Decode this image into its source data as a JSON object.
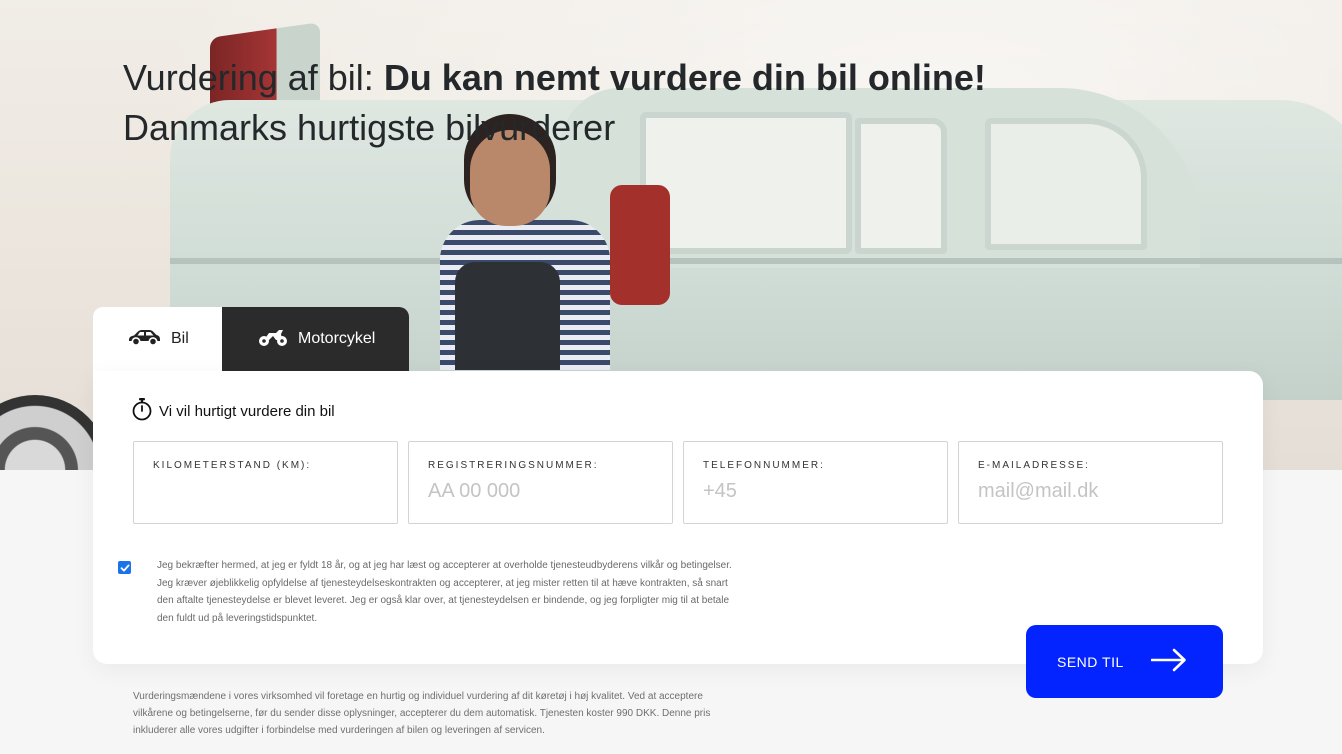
{
  "hero": {
    "title_prefix": "Vurdering af bil: ",
    "title_bold": "Du kan nemt vurdere din bil online!",
    "subtitle": "Danmarks hurtigste bilvurderer"
  },
  "tabs": [
    {
      "label": "Bil",
      "icon": "car-icon",
      "active": true
    },
    {
      "label": "Motorcykel",
      "icon": "motorcycle-icon",
      "active": false
    }
  ],
  "form": {
    "heading": "Vi vil hurtigt vurdere din bil",
    "heading_icon": "stopwatch-icon",
    "fields": [
      {
        "label": "KILOMETERSTAND (KM):",
        "placeholder": "",
        "value": ""
      },
      {
        "label": "REGISTRERINGSNUMMER:",
        "placeholder": "AA 00 000",
        "value": ""
      },
      {
        "label": "TELEFONNUMMER:",
        "placeholder": "+45",
        "value": ""
      },
      {
        "label": "E-MAILADRESSE:",
        "placeholder": "mail@mail.dk",
        "value": ""
      }
    ],
    "consent": {
      "checked": true,
      "text": "Jeg bekræfter hermed, at jeg er fyldt 18 år, og at jeg har læst og accepterer at overholde tjenesteudbyderens vilkår og betingelser. Jeg kræver øjeblikkelig opfyldelse af tjenesteydelseskontrakten og accepterer, at jeg mister retten til at hæve kontrakten, så snart den aftalte tjenesteydelse er blevet leveret. Jeg er også klar over, at tjenesteydelsen er bindende, og jeg forpligter mig til at betale den fuldt ud på leveringstidspunktet."
    },
    "submit_label": "SEND TIL",
    "submit_icon": "arrow-right-icon"
  },
  "footer": {
    "note": "Vurderingsmændene i vores virksomhed vil foretage en hurtig og individuel vurdering af dit køretøj i høj kvalitet. Ved at acceptere vilkårene og betingelserne, før du sender disse oplysninger, accepterer du dem automatisk. Tjenesten koster 990 DKK. Denne pris inkluderer alle vores udgifter i forbindelse med vurderingen af bilen og leveringen af servicen."
  },
  "colors": {
    "accent": "#0424ff",
    "checkbox": "#1a73e8",
    "tab_inactive_bg": "#2b2b2b"
  }
}
